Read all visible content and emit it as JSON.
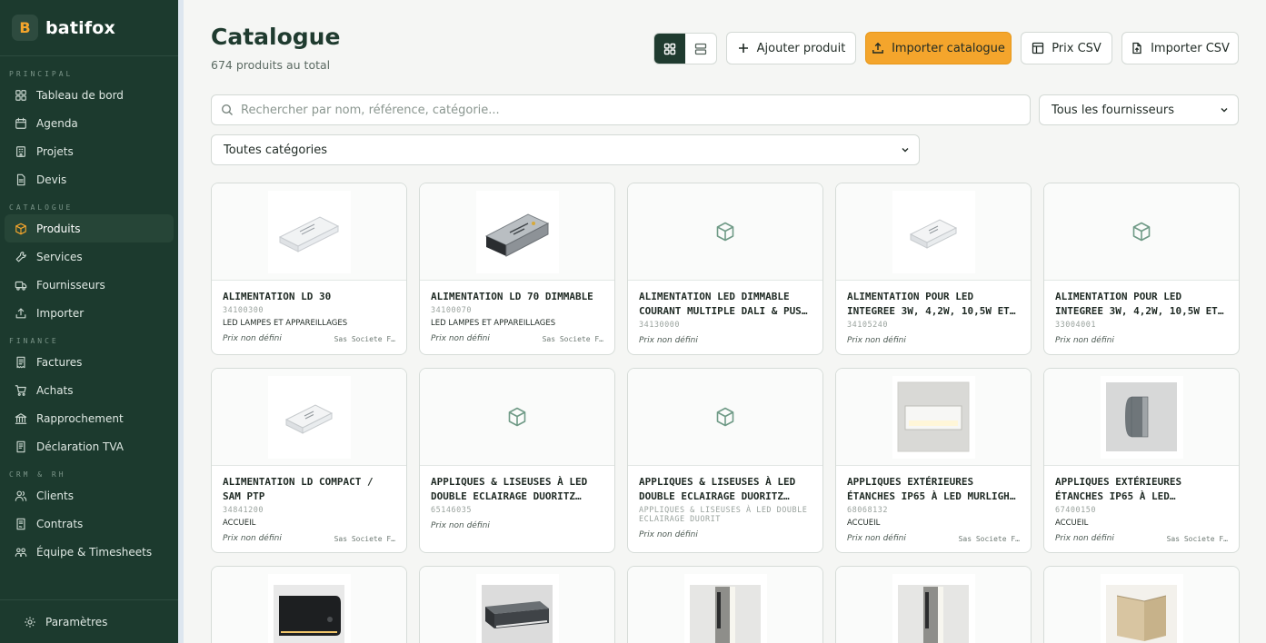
{
  "sidebar": {
    "brand": {
      "logo_letter": "B",
      "name": "batifox"
    },
    "sections": [
      {
        "title": "PRINCIPAL",
        "items": [
          {
            "label": "Tableau de bord",
            "icon": "grid-icon"
          },
          {
            "label": "Agenda",
            "icon": "calendar-icon"
          },
          {
            "label": "Projets",
            "icon": "building-icon"
          },
          {
            "label": "Devis",
            "icon": "document-icon"
          }
        ]
      },
      {
        "title": "CATALOGUE",
        "items": [
          {
            "label": "Produits",
            "icon": "box-icon",
            "active": true
          },
          {
            "label": "Services",
            "icon": "wrench-icon"
          },
          {
            "label": "Fournisseurs",
            "icon": "truck-icon"
          },
          {
            "label": "Importer",
            "icon": "upload-icon"
          }
        ]
      },
      {
        "title": "FINANCE",
        "items": [
          {
            "label": "Factures",
            "icon": "invoice-icon"
          },
          {
            "label": "Achats",
            "icon": "cart-icon"
          },
          {
            "label": "Rapprochement",
            "icon": "bank-icon"
          },
          {
            "label": "Déclaration TVA",
            "icon": "tax-icon"
          }
        ]
      },
      {
        "title": "CRM & RH",
        "items": [
          {
            "label": "Clients",
            "icon": "users-icon"
          },
          {
            "label": "Contrats",
            "icon": "contract-icon"
          },
          {
            "label": "Équipe & Timesheets",
            "icon": "team-icon"
          }
        ]
      }
    ],
    "footer": {
      "label": "Paramètres",
      "icon": "gear-icon"
    }
  },
  "header": {
    "title": "Catalogue",
    "subtitle": "674 produits au total",
    "buttons": {
      "add": "Ajouter produit",
      "import_catalogue": "Importer catalogue",
      "price_csv": "Prix CSV",
      "import_csv": "Importer CSV"
    }
  },
  "filters": {
    "search_placeholder": "Rechercher par nom, référence, catégorie...",
    "supplier": "Tous les fournisseurs",
    "category": "Toutes catégories"
  },
  "colors": {
    "accent": "#f4a52c",
    "sidebar": "#1c3a2e",
    "active_toggle": "#1f3b2f"
  },
  "products": [
    {
      "name": "ALIMENTATION LD 30",
      "ref": "34100300",
      "category": "LED LAMPES ET APPAREILLAGES",
      "price": "Prix non défini",
      "supplier": "Sas Societe F…",
      "image": "white-driver"
    },
    {
      "name": "ALIMENTATION LD 70 DIMMABLE",
      "ref": "34100070",
      "category": "LED LAMPES ET APPAREILLAGES",
      "price": "Prix non défini",
      "supplier": "Sas Societe F…",
      "image": "grey-driver"
    },
    {
      "name": "ALIMENTATION LED DIMMABLE COURANT MULTIPLE DALI & PUSH …",
      "ref": "34130000",
      "category": "",
      "price": "Prix non défini",
      "supplier": "",
      "image": "placeholder"
    },
    {
      "name": "ALIMENTATION POUR LED INTEGREE 3W, 4,2W, 10,5W et 14W COMPAC…",
      "ref": "34105240",
      "category": "",
      "price": "Prix non défini",
      "supplier": "",
      "image": "small-driver"
    },
    {
      "name": "ALIMENTATION POUR LED INTEGREE 3W, 4,2W, 10,5W et 14W MINI…",
      "ref": "33004001",
      "category": "",
      "price": "Prix non défini",
      "supplier": "",
      "image": "placeholder"
    },
    {
      "name": "ALIMENTATION LD COMPACT / SAM PTP",
      "ref": "34841200",
      "category": "Accueil",
      "price": "Prix non défini",
      "supplier": "Sas Societe F…",
      "image": "small-driver"
    },
    {
      "name": "APPLIQUES & LISEUSES À LED DOUBLE ECLAIRAGE DUORITZ NOIR",
      "ref": "65146035",
      "category": "",
      "price": "Prix non défini",
      "supplier": "",
      "image": "placeholder"
    },
    {
      "name": "APPLIQUES & LISEUSES À LED DOUBLE ECLAIRAGE DUORITZ NOIR",
      "ref": "APPLIQUES & LISEUSES À LED DOUBLE ECLAIRAGE DUORIT",
      "category": "",
      "price": "Prix non défini",
      "supplier": "",
      "image": "placeholder"
    },
    {
      "name": "APPLIQUES EXTÉRIEURES ÉTANCHES IP65 À LED MURLIGHT BLANC",
      "ref": "68068132",
      "category": "Accueil",
      "price": "Prix non défini",
      "supplier": "Sas Societe F…",
      "image": "wall-light-white"
    },
    {
      "name": "APPLIQUES EXTÉRIEURES ÉTANCHES IP65 À LED WALLIGHT/E GRIS",
      "ref": "67400150",
      "category": "Accueil",
      "price": "Prix non défini",
      "supplier": "Sas Societe F…",
      "image": "wall-light-grey"
    },
    {
      "name": "",
      "ref": "",
      "category": "",
      "price": "",
      "supplier": "",
      "image": "black-wall-light"
    },
    {
      "name": "",
      "ref": "",
      "category": "",
      "price": "",
      "supplier": "",
      "image": "dark-bar-light"
    },
    {
      "name": "",
      "ref": "",
      "category": "",
      "price": "",
      "supplier": "",
      "image": "bollard"
    },
    {
      "name": "",
      "ref": "",
      "category": "",
      "price": "",
      "supplier": "",
      "image": "bollard"
    },
    {
      "name": "",
      "ref": "",
      "category": "",
      "price": "",
      "supplier": "",
      "image": "beige-light"
    }
  ]
}
